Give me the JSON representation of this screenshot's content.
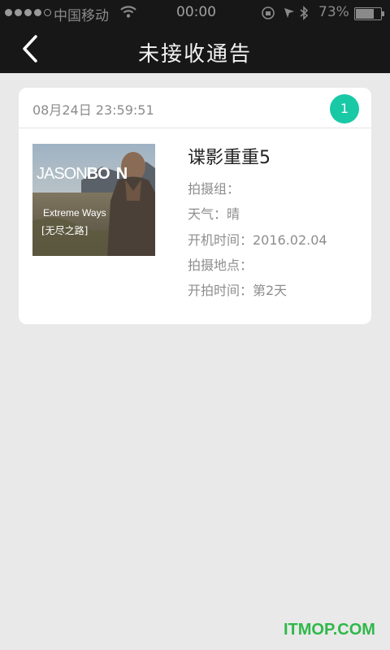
{
  "status_bar": {
    "carrier": "中国移动",
    "time": "00:00",
    "battery_percent": "73%",
    "battery_level": 0.73,
    "icons": [
      "signal-dots-icon",
      "wifi-icon",
      "lock-rotation-icon",
      "location-icon",
      "bluetooth-icon",
      "battery-icon"
    ]
  },
  "nav": {
    "title": "未接收通告",
    "back_icon": "chevron-left-icon"
  },
  "notices": [
    {
      "datetime": "08月24日 23:59:51",
      "count": "1",
      "poster": {
        "title_a": "JASON",
        "title_b": "BO",
        "title_c": "N",
        "subtitle_en": "Extreme Ways",
        "subtitle_cn": "[无尽之路]"
      },
      "title": "谍影重重5",
      "crew": "拍摄组：",
      "weather": "天气：晴",
      "start_time": "开机时间：2016.02.04",
      "location": "拍摄地点：",
      "shoot_day": "开拍时间：第2天"
    }
  ],
  "watermark": "ITMOP.COM",
  "colors": {
    "header_bg": "#171717",
    "badge": "#19c9a6",
    "page_bg": "#e9e9e9",
    "watermark": "#2fb84a"
  }
}
